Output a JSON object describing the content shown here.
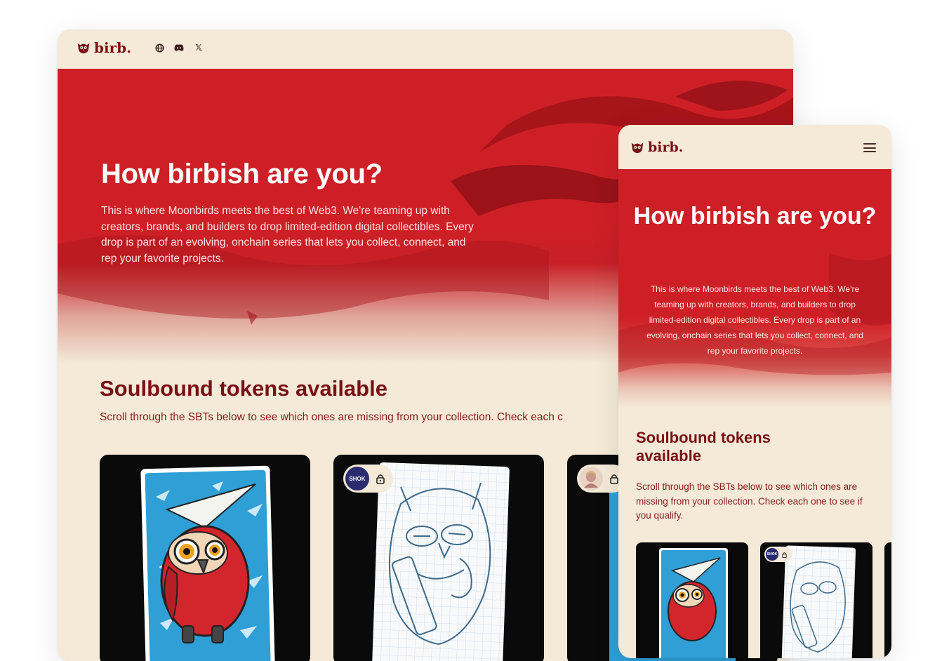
{
  "brand": {
    "name": "birb.",
    "logo_icon": "owl-face-icon",
    "color": "#7a1016"
  },
  "colors": {
    "hero_red": "#cf1f26",
    "cream": "#f4ead7",
    "heading_dark_red": "#7a1016"
  },
  "desktop": {
    "social_icons": [
      "globe-icon",
      "discord-icon",
      "x-icon"
    ],
    "social_x_glyph": "𝕏",
    "hero": {
      "title": "How birbish are you?",
      "body": "This is where Moonbirds meets the best of Web3. We're teaming up with creators, brands, and builders to drop limited-edition digital collectibles. Every drop is part of an evolving, onchain series that lets you collect, connect, and rep your favorite projects."
    },
    "sbt": {
      "title": "Soulbound tokens available",
      "description": "Scroll through the SBTs below to see which ones are missing from your collection. Check each c"
    },
    "cards": [
      {
        "name": "paper-plane-owl",
        "badge": false
      },
      {
        "name": "sketch-owl",
        "badge": true,
        "badge_label": "SHOK"
      },
      {
        "name": "third-owl",
        "badge": true,
        "badge_label": ""
      }
    ]
  },
  "mobile": {
    "menu_icon": "hamburger-menu-icon",
    "hero": {
      "title": "How birbish are you?",
      "body": "This is where Moonbirds meets the best of Web3. We're teaming up with creators, brands, and builders to drop limited-edition digital collectibles. Every drop is part of an evolving, onchain series that lets you collect, connect, and rep your favorite projects."
    },
    "sbt": {
      "title": "Soulbound tokens available",
      "description": "Scroll through the SBTs below to see which ones are missing from your collection. Check each one to see if you qualify."
    }
  }
}
